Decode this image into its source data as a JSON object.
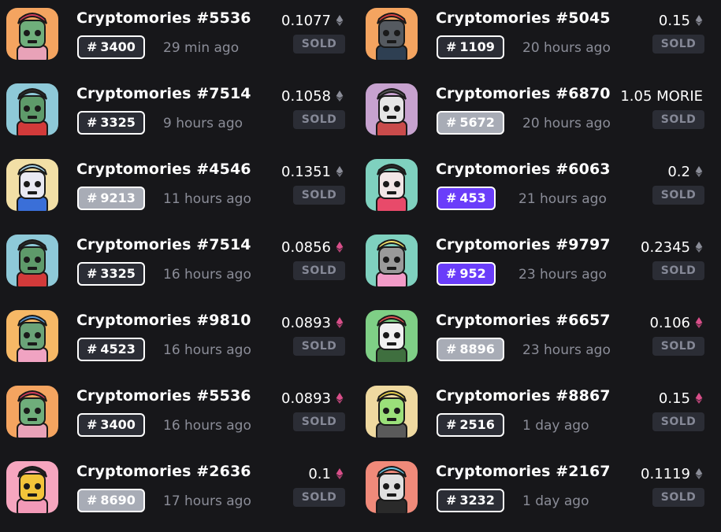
{
  "colors": {
    "background": "#17171a",
    "rank_default": "#2b2d35",
    "rank_light": "#a8acb6",
    "rank_purple": "#6a3dfa",
    "sold_badge": "#2b2d35",
    "eth_gray": "#8b8d98",
    "eth_pink": "#d94f8a"
  },
  "sales": [
    {
      "title": "Cryptomories #5536",
      "rank": "3400",
      "rank_style": "dark",
      "time": "29 min ago",
      "price": "0.1077",
      "currency_icon": "eth-gray-icon",
      "status": "SOLD",
      "avatar": {
        "bg": "#f4a460",
        "skin": "#6fae7b",
        "hair": "#d63b5a",
        "shirt": "#e8a2b8"
      }
    },
    {
      "title": "Cryptomories #5045",
      "rank": "1109",
      "rank_style": "dark",
      "time": "20 hours ago",
      "price": "0.15",
      "currency_icon": "eth-gray-icon",
      "status": "SOLD",
      "avatar": {
        "bg": "#f4a460",
        "skin": "#555a60",
        "hair": "#e04040",
        "shirt": "#2e3f52"
      }
    },
    {
      "title": "Cryptomories #7514",
      "rank": "3325",
      "rank_style": "dark",
      "time": "9 hours ago",
      "price": "0.1058",
      "currency_icon": "eth-gray-icon",
      "status": "SOLD",
      "avatar": {
        "bg": "#8ec9d8",
        "skin": "#5e9a6a",
        "hair": "#2a2a2a",
        "shirt": "#d23a3a"
      }
    },
    {
      "title": "Cryptomories #6870",
      "rank": "5672",
      "rank_style": "light",
      "time": "20 hours ago",
      "price": "1.05 MORIE",
      "currency_icon": "",
      "status": "SOLD",
      "avatar": {
        "bg": "#c7a2cf",
        "skin": "#e6e6e6",
        "hair": "#555555",
        "shirt": "#c94b4b"
      }
    },
    {
      "title": "Cryptomories #4546",
      "rank": "9213",
      "rank_style": "light",
      "time": "11 hours ago",
      "price": "0.1351",
      "currency_icon": "eth-gray-icon",
      "status": "SOLD",
      "avatar": {
        "bg": "#f2dfa6",
        "skin": "#e9e9f2",
        "hair": "#a8d4ea",
        "shirt": "#3a6fd8"
      }
    },
    {
      "title": "Cryptomories #6063",
      "rank": "453",
      "rank_style": "purple",
      "time": "21 hours ago",
      "price": "0.2",
      "currency_icon": "eth-gray-icon",
      "status": "SOLD",
      "avatar": {
        "bg": "#7fd1bf",
        "skin": "#f1e6e6",
        "hair": "#2a2a2a",
        "shirt": "#e84a6a"
      }
    },
    {
      "title": "Cryptomories #7514",
      "rank": "3325",
      "rank_style": "dark",
      "time": "16 hours ago",
      "price": "0.0856",
      "currency_icon": "eth-pink-icon",
      "status": "SOLD",
      "avatar": {
        "bg": "#8ec9d8",
        "skin": "#5e9a6a",
        "hair": "#2a2a2a",
        "shirt": "#d23a3a"
      }
    },
    {
      "title": "Cryptomories #9797",
      "rank": "952",
      "rank_style": "purple",
      "time": "23 hours ago",
      "price": "0.2345",
      "currency_icon": "eth-gray-icon",
      "status": "SOLD",
      "avatar": {
        "bg": "#7fd1bf",
        "skin": "#9a9a9a",
        "hair": "#f4e36a",
        "shirt": "#f29bc7"
      }
    },
    {
      "title": "Cryptomories #9810",
      "rank": "4523",
      "rank_style": "dark",
      "time": "16 hours ago",
      "price": "0.0893",
      "currency_icon": "eth-pink-icon",
      "status": "SOLD",
      "avatar": {
        "bg": "#f6b866",
        "skin": "#6aa378",
        "hair": "#5b9bd8",
        "shirt": "#f0a3c2"
      }
    },
    {
      "title": "Cryptomories #6657",
      "rank": "8896",
      "rank_style": "light",
      "time": "23 hours ago",
      "price": "0.106",
      "currency_icon": "eth-pink-icon",
      "status": "SOLD",
      "avatar": {
        "bg": "#7fcf86",
        "skin": "#f0f0f0",
        "hair": "#e05050",
        "shirt": "#3f6f3f"
      }
    },
    {
      "title": "Cryptomories #5536",
      "rank": "3400",
      "rank_style": "dark",
      "time": "16 hours ago",
      "price": "0.0893",
      "currency_icon": "eth-pink-icon",
      "status": "SOLD",
      "avatar": {
        "bg": "#f4a460",
        "skin": "#6fae7b",
        "hair": "#d63b5a",
        "shirt": "#e8a2b8"
      }
    },
    {
      "title": "Cryptomories #8867",
      "rank": "2516",
      "rank_style": "dark",
      "time": "1 day ago",
      "price": "0.15",
      "currency_icon": "eth-pink-icon",
      "status": "SOLD",
      "avatar": {
        "bg": "#efd9a0",
        "skin": "#9be07a",
        "hair": "#e8d04a",
        "shirt": "#5a5a5a"
      }
    },
    {
      "title": "Cryptomories #2636",
      "rank": "8690",
      "rank_style": "light",
      "time": "17 hours ago",
      "price": "0.1",
      "currency_icon": "eth-pink-icon",
      "status": "SOLD",
      "avatar": {
        "bg": "#f6a6bf",
        "skin": "#f2c43a",
        "hair": "#222222",
        "shirt": "#f39ab8"
      }
    },
    {
      "title": "Cryptomories #2167",
      "rank": "3232",
      "rank_style": "dark",
      "time": "1 day ago",
      "price": "0.1119",
      "currency_icon": "eth-gray-icon",
      "status": "SOLD",
      "avatar": {
        "bg": "#f08a7a",
        "skin": "#e0e0e0",
        "hair": "#6ac8e8",
        "shirt": "#2a2a2a"
      }
    }
  ]
}
